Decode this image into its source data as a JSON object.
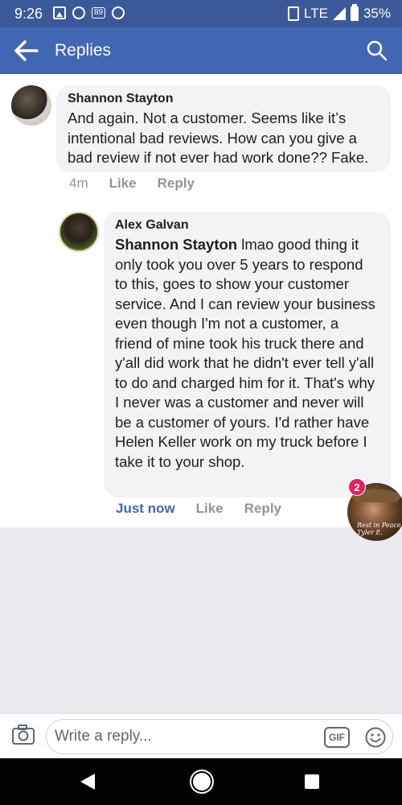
{
  "status_bar": {
    "time": "9:26",
    "left_icons": [
      "photo-icon",
      "messenger-icon",
      "notification-count-icon",
      "messenger-icon"
    ],
    "notification_count": "89",
    "network": "LTE",
    "battery": "35%"
  },
  "app_bar": {
    "title": "Replies",
    "back_icon": "arrow-left-icon",
    "search_icon": "search-icon"
  },
  "comments": [
    {
      "author": "Shannon Stayton",
      "text": "And again. Not a customer. Seems like it’s intentional bad reviews. How can you give a bad review if not ever had work done?? Fake.",
      "time": "4m",
      "like_label": "Like",
      "reply_label": "Reply"
    },
    {
      "author": "Alex Galvan",
      "mention": "Shannon Stayton",
      "text": " lmao good thing it only took you over 5 years to respond to this, goes to show your customer service. And I can review your business even though I'm not a customer, a friend of mine took his truck there and y'all did work that he didn't ever tell y'all to do and charged him for it. That's why I never was a customer and never will be a customer of yours. I'd rather have Helen Keller work on my truck before I take it to your shop.",
      "time": "Just now",
      "like_label": "Like",
      "reply_label": "Reply"
    }
  ],
  "chat_head": {
    "badge_count": "2",
    "caption": "Rest in Peace Tyler E."
  },
  "reply_bar": {
    "placeholder": "Write a reply...",
    "gif_label": "GIF",
    "camera_icon": "camera-icon",
    "emoji_icon": "smiley-icon"
  },
  "nav_bar": {
    "icons": [
      "back-triangle-icon",
      "home-circle-icon",
      "recents-square-icon"
    ]
  },
  "colors": {
    "brand_blue": "#4267b2",
    "status_blue": "#3b5998",
    "bubble_gray": "#f2f3f5",
    "meta_gray": "#90949c",
    "badge_red": "#e0245e"
  }
}
